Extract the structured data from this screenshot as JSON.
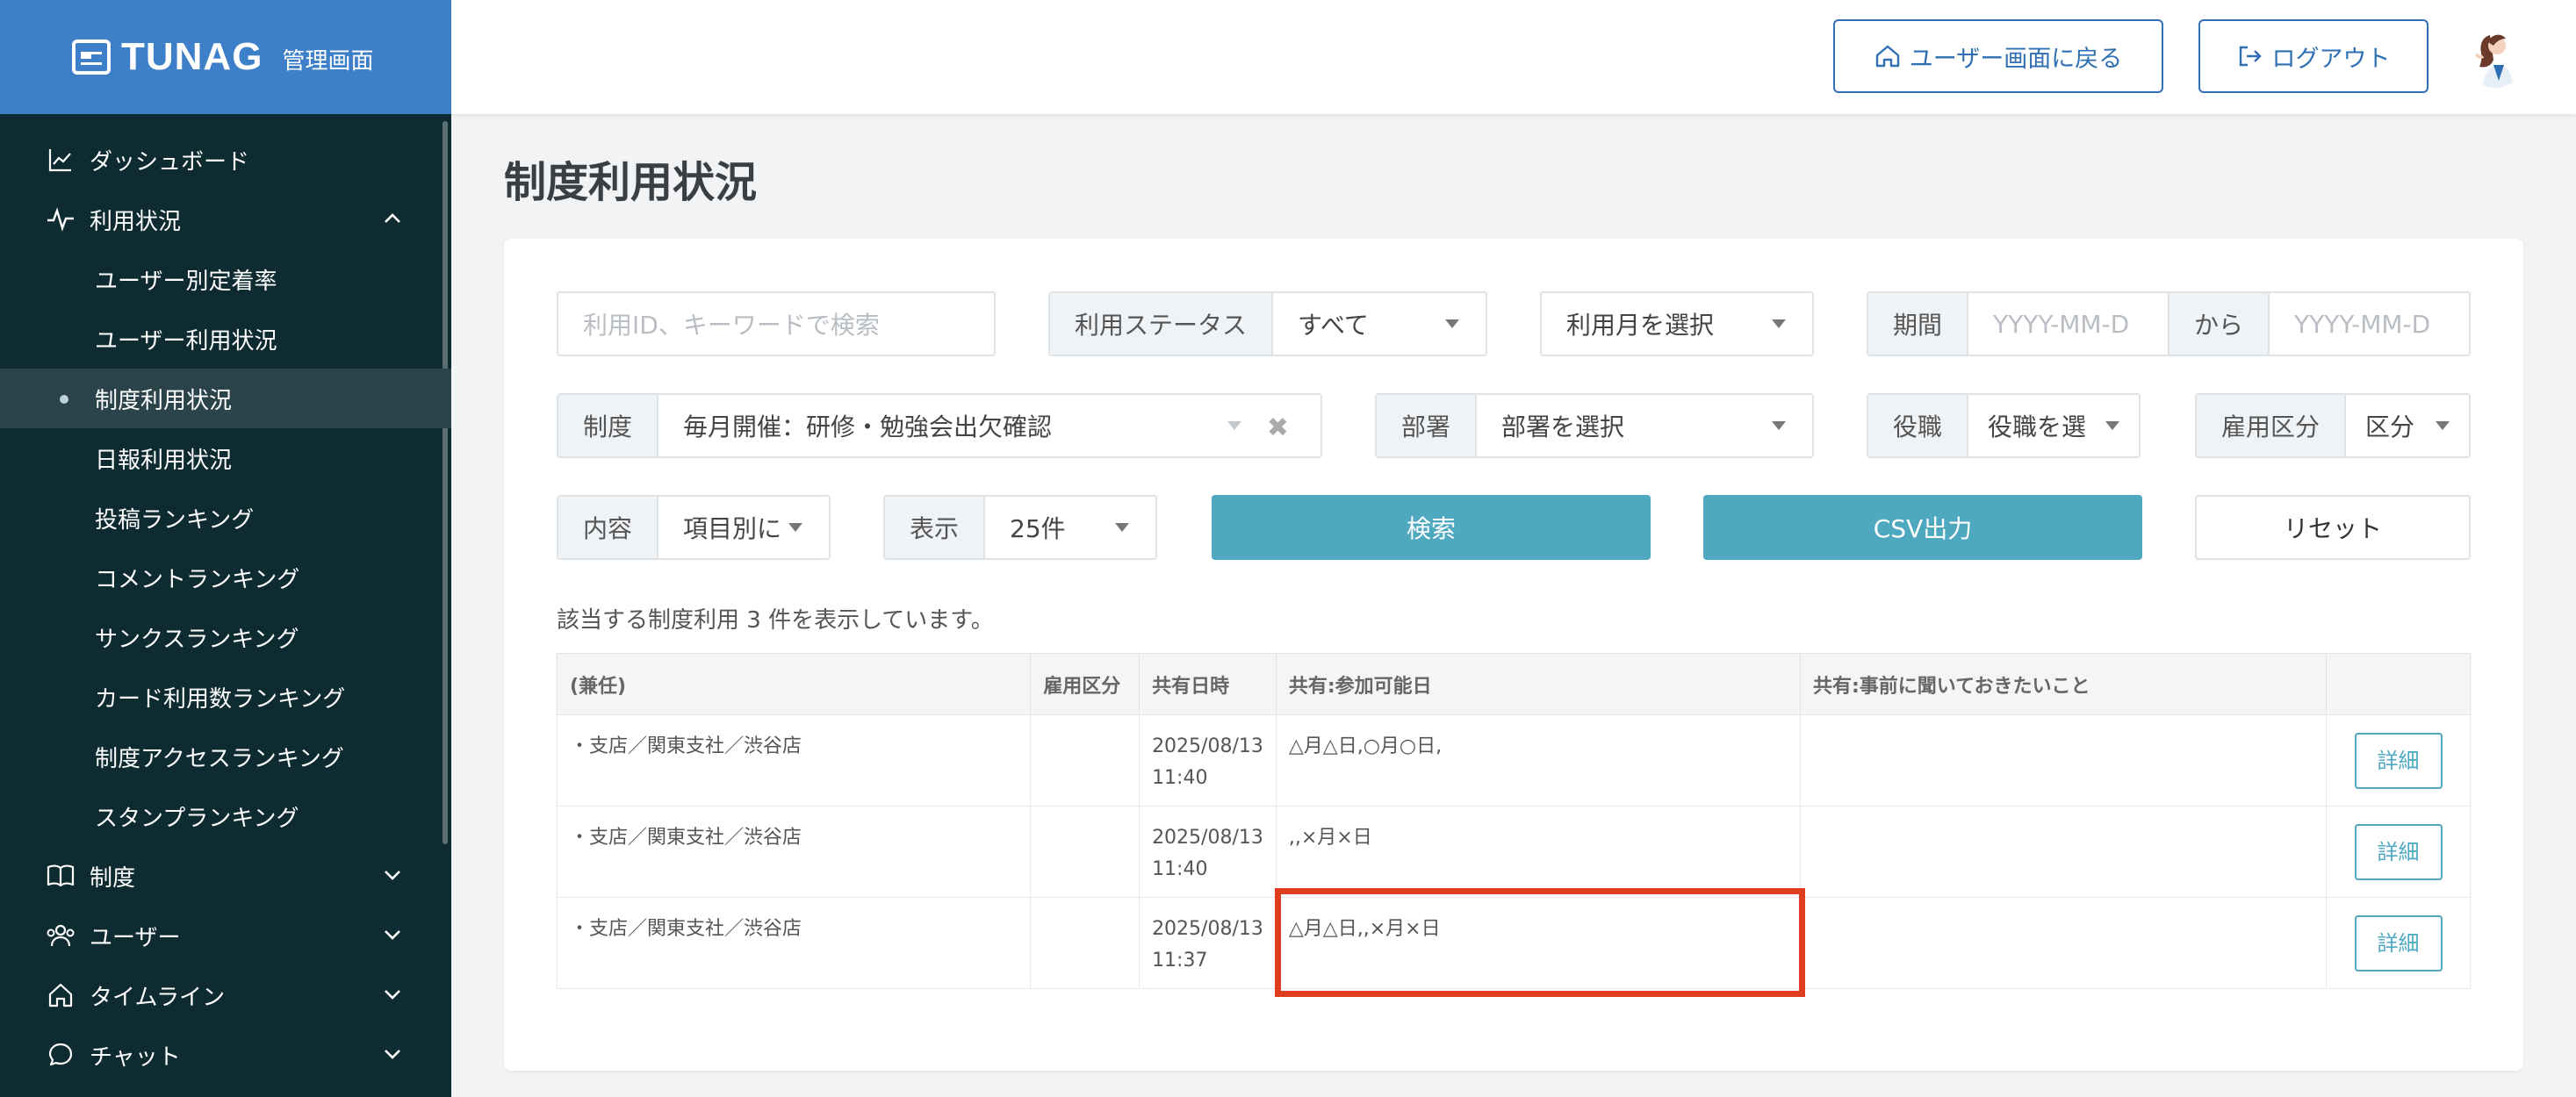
{
  "brand": {
    "name": "TUNAG",
    "sub": "管理画面"
  },
  "header": {
    "back_label": "ユーザー画面に戻る",
    "logout_label": "ログアウト"
  },
  "sidebar": {
    "items": [
      {
        "label": "ダッシュボード"
      },
      {
        "label": "利用状況"
      },
      {
        "label": "ユーザー別定着率"
      },
      {
        "label": "ユーザー利用状況"
      },
      {
        "label": "制度利用状況"
      },
      {
        "label": "日報利用状況"
      },
      {
        "label": "投稿ランキング"
      },
      {
        "label": "コメントランキング"
      },
      {
        "label": "サンクスランキング"
      },
      {
        "label": "カード利用数ランキング"
      },
      {
        "label": "制度アクセスランキング"
      },
      {
        "label": "スタンプランキング"
      },
      {
        "label": "制度"
      },
      {
        "label": "ユーザー"
      },
      {
        "label": "タイムライン"
      },
      {
        "label": "チャット"
      }
    ]
  },
  "page": {
    "title": "制度利用状況"
  },
  "filters": {
    "search_placeholder": "利用ID、キーワードで検索",
    "status_label": "利用ステータス",
    "status_value": "すべて",
    "month_value": "利用月を選択",
    "period_label": "期間",
    "period_from_placeholder": "YYYY-MM-D",
    "period_sep": "から",
    "period_to_placeholder": "YYYY-MM-D",
    "system_label": "制度",
    "system_value": "毎月開催：研修・勉強会出欠確認",
    "dept_label": "部署",
    "dept_value": "部署を選択",
    "role_label": "役職",
    "role_value": "役職を選",
    "employ_label": "雇用区分",
    "employ_value": "区分",
    "content_label": "内容",
    "content_value": "項目別に",
    "display_label": "表示",
    "display_value": "25件",
    "search_btn": "検索",
    "csv_btn": "CSV出力",
    "reset_btn": "リセット"
  },
  "results": {
    "summary": "該当する制度利用 3 件を表示しています。"
  },
  "table": {
    "headers": [
      "(兼任)",
      "雇用区分",
      "共有日時",
      "共有:参加可能日",
      "共有:事前に聞いておきたいこと",
      ""
    ],
    "rows": [
      {
        "dept": "・支店／関東支社／渋谷店",
        "employ": "",
        "date": "2025/08/13",
        "time": "11:40",
        "days": "△月△日,○月○日,",
        "ask": "",
        "action": "詳細"
      },
      {
        "dept": "・支店／関東支社／渋谷店",
        "employ": "",
        "date": "2025/08/13",
        "time": "11:40",
        "days": ",,×月×日",
        "ask": "",
        "action": "詳細"
      },
      {
        "dept": "・支店／関東支社／渋谷店",
        "employ": "",
        "date": "2025/08/13",
        "time": "11:37",
        "days": "△月△日,,×月×日",
        "ask": "",
        "action": "詳細"
      }
    ]
  },
  "colors": {
    "sidebar_bg": "#0f2b32",
    "brand_bg": "#3d7fc9",
    "accent": "#4ea8c0",
    "highlight": "#e03c1f",
    "link": "#2f6fb3"
  }
}
